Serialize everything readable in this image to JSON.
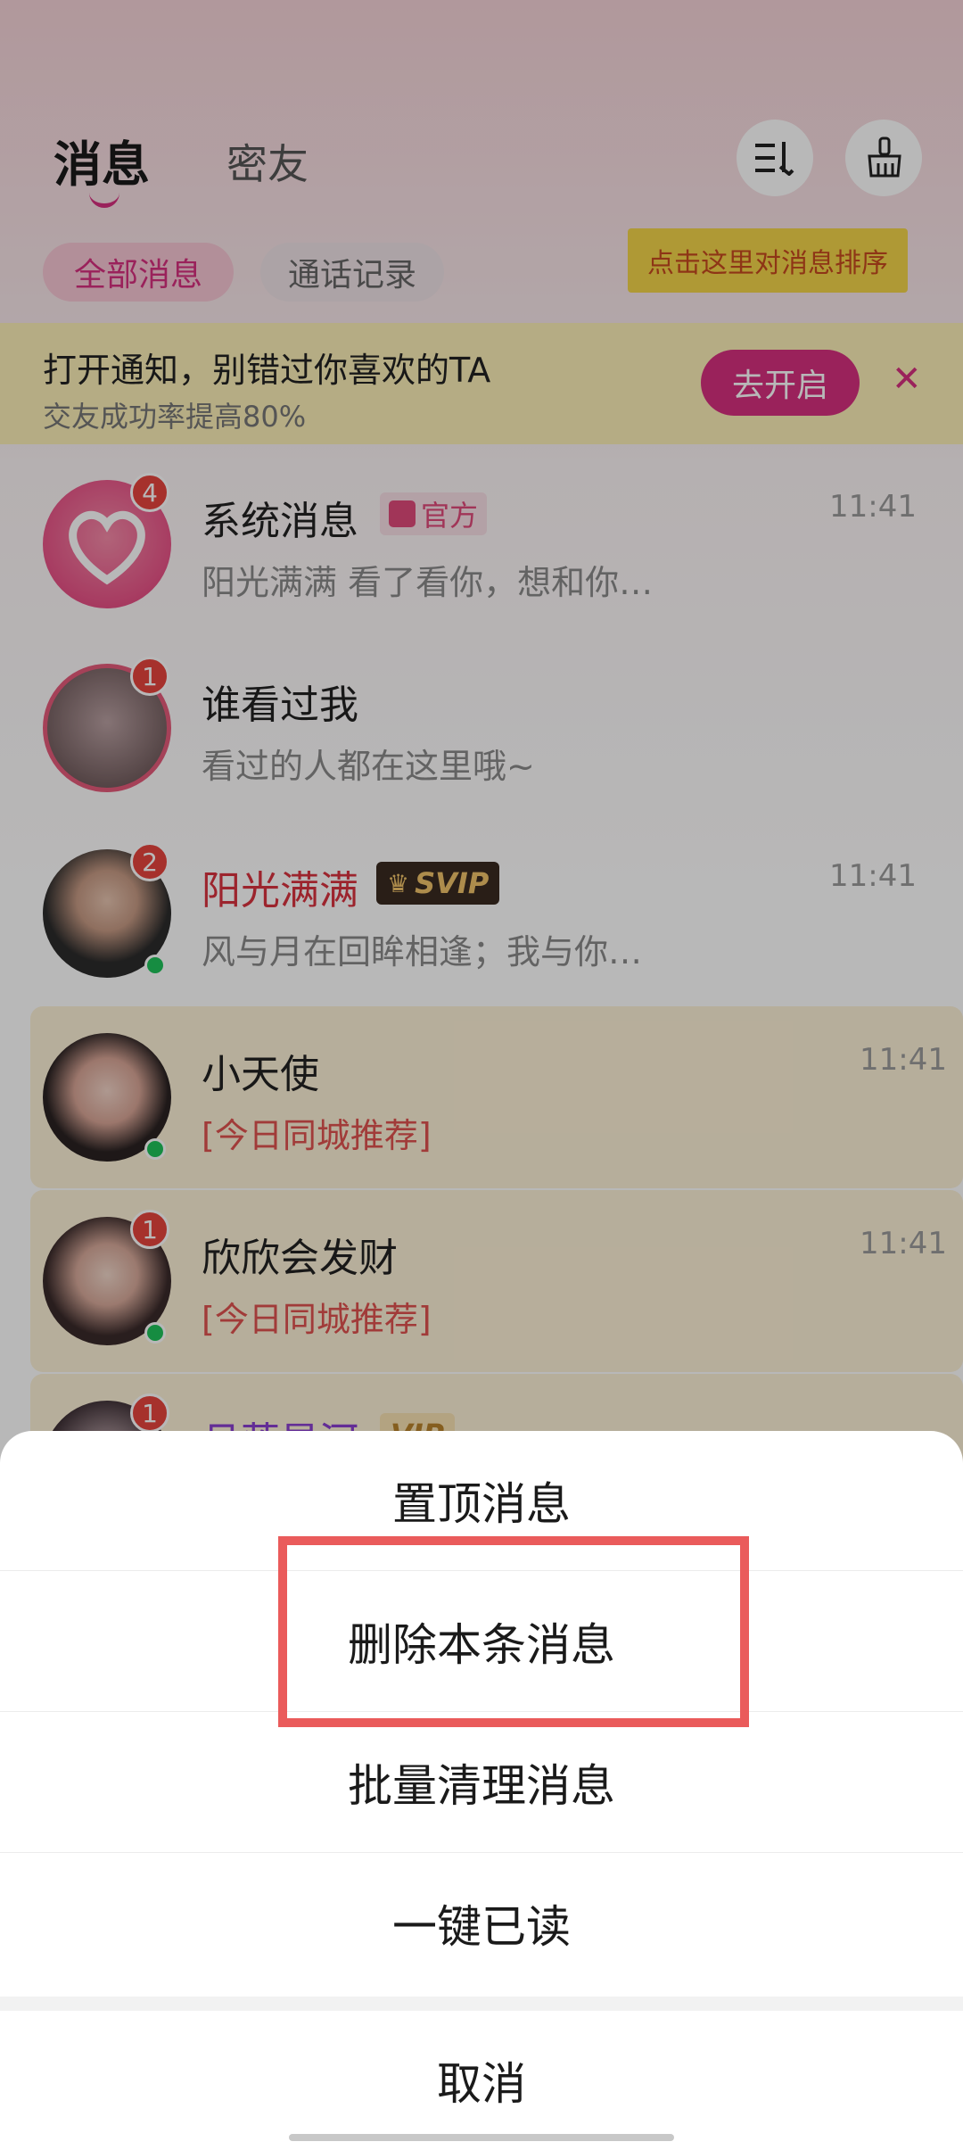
{
  "header": {
    "tab_active": "消息",
    "tab_inactive": "密友",
    "icons": [
      "sort-list-icon",
      "broom-clean-icon"
    ]
  },
  "filters": {
    "all": "全部消息",
    "calls": "通话记录",
    "sort_tip": "点击这里对消息排序"
  },
  "notice": {
    "title": "打开通知，别错过你喜欢的TA",
    "subtitle": "交友成功率提高80%",
    "button": "去开启",
    "close": "✕"
  },
  "conversations": [
    {
      "name": "系统消息",
      "tag": "官方",
      "preview": "阳光满满 看了看你，想和你…",
      "time": "11:41",
      "badge": "4"
    },
    {
      "name": "谁看过我",
      "tag": "",
      "preview": "看过的人都在这里哦~",
      "time": "",
      "badge": "1"
    },
    {
      "name": "阳光满满",
      "tag": "SVIP",
      "preview": "风与月在回眸相逢；我与你…",
      "time": "11:41",
      "badge": "2"
    },
    {
      "name": "小天使",
      "tag": "",
      "preview": "[今日同城推荐]",
      "time": "11:41",
      "badge": ""
    },
    {
      "name": "欣欣会发财",
      "tag": "",
      "preview": "[今日同城推荐]",
      "time": "11:41",
      "badge": "1"
    },
    {
      "name": "月落星河",
      "tag": "VIP",
      "preview": "",
      "time": "",
      "badge": "1"
    }
  ],
  "sheet": {
    "items": [
      "置顶消息",
      "删除本条消息",
      "批量清理消息",
      "一键已读"
    ],
    "cancel": "取消"
  },
  "colors": {
    "accent": "#d6307f",
    "badge": "#e7443e",
    "highlight": "#ea5b5b",
    "vip_name": "#d9323f",
    "recommend": "#e0524f"
  }
}
